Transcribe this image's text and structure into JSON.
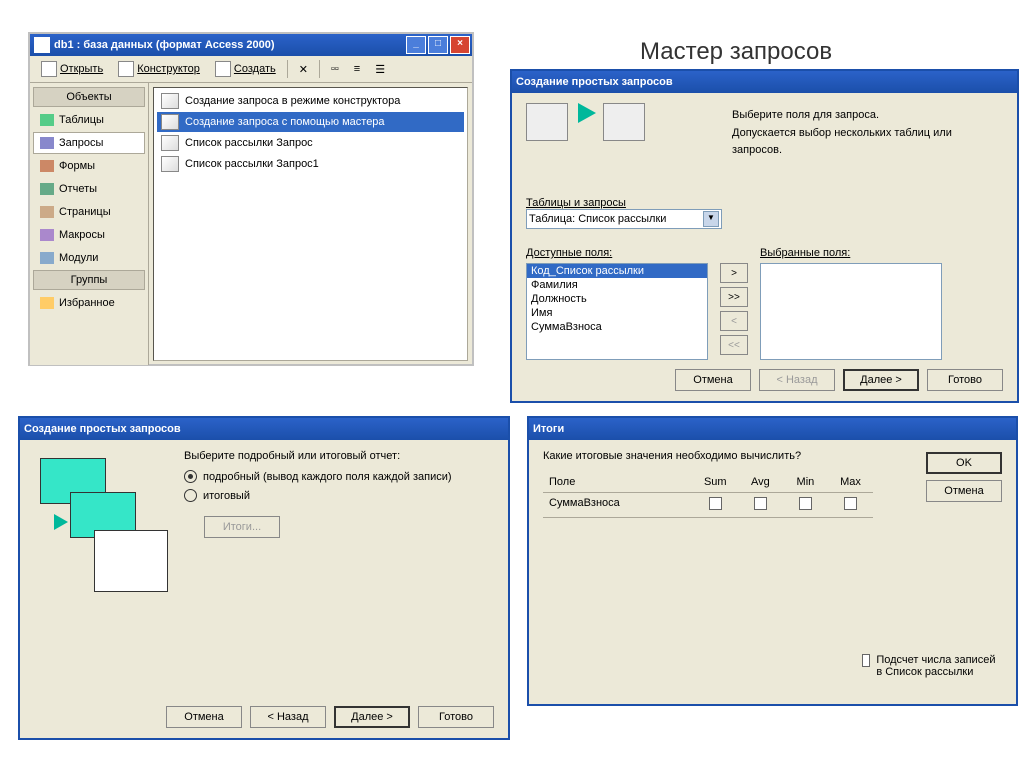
{
  "page_title": "Мастер запросов",
  "win1": {
    "title": "db1 : база данных (формат Access 2000)",
    "toolbar": {
      "open": "Открыть",
      "design": "Конструктор",
      "create": "Создать"
    },
    "sidebar": {
      "objects_hdr": "Объекты",
      "items": [
        {
          "label": "Таблицы"
        },
        {
          "label": "Запросы"
        },
        {
          "label": "Формы"
        },
        {
          "label": "Отчеты"
        },
        {
          "label": "Страницы"
        },
        {
          "label": "Макросы"
        },
        {
          "label": "Модули"
        }
      ],
      "groups_hdr": "Группы",
      "groups": [
        {
          "label": "Избранное"
        }
      ]
    },
    "list": [
      "Создание запроса в режиме конструктора",
      "Создание запроса с помощью мастера",
      "Список рассылки Запрос",
      "Список рассылки Запрос1"
    ]
  },
  "win2": {
    "title": "Создание простых запросов",
    "instr1": "Выберите поля для запроса.",
    "instr2": "Допускается выбор нескольких таблиц или запросов.",
    "tables_lbl": "Таблицы и запросы",
    "combo_val": "Таблица: Список рассылки",
    "avail_lbl": "Доступные поля:",
    "sel_lbl": "Выбранные поля:",
    "avail": [
      "Код_Список рассылки",
      "Фамилия",
      "Должность",
      "Имя",
      "СуммаВзноса"
    ],
    "btns": {
      "cancel": "Отмена",
      "back": "< Назад",
      "next": "Далее >",
      "finish": "Готово"
    },
    "move": {
      "r": ">",
      "rr": ">>",
      "l": "<",
      "ll": "<<"
    }
  },
  "win3": {
    "title": "Создание простых запросов",
    "heading": "Выберите подробный или итоговый отчет:",
    "options": {
      "detail": "подробный (вывод каждого поля каждой записи)",
      "summary": "итоговый"
    },
    "itogi_btn": "Итоги...",
    "btns": {
      "cancel": "Отмена",
      "back": "< Назад",
      "next": "Далее >",
      "finish": "Готово"
    }
  },
  "win4": {
    "title": "Итоги",
    "prompt": "Какие итоговые значения необходимо вычислить?",
    "cols": {
      "field": "Поле",
      "sum": "Sum",
      "avg": "Avg",
      "min": "Min",
      "max": "Max"
    },
    "rows": [
      {
        "field": "СуммаВзноса"
      }
    ],
    "ok": "OK",
    "cancel": "Отмена",
    "count_lbl": "Подсчет числа записей в Список рассылки"
  }
}
